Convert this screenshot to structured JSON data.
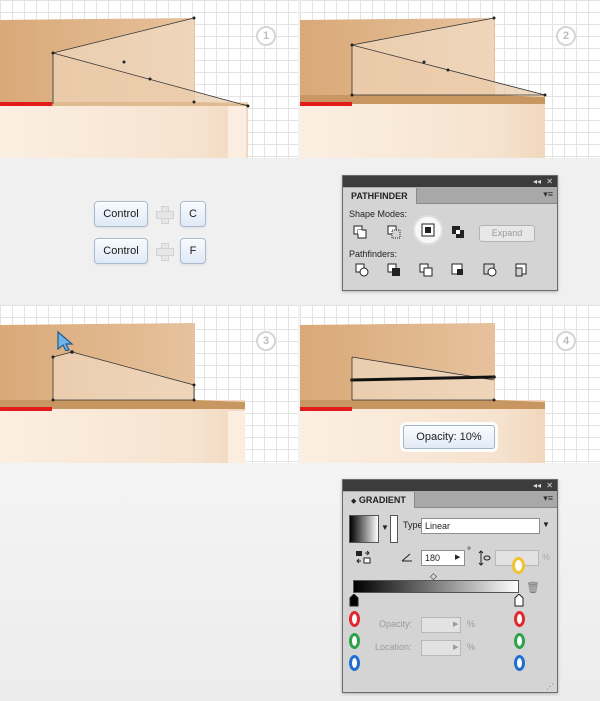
{
  "steps": [
    "1",
    "2",
    "3",
    "4"
  ],
  "shortcuts": {
    "row1": {
      "modifier": "Control",
      "key": "C"
    },
    "row2": {
      "modifier": "Control",
      "key": "F"
    }
  },
  "pathfinder": {
    "title": "PATHFINDER",
    "shape_modes_label": "Shape Modes:",
    "pathfinders_label": "Pathfinders:",
    "expand_label": "Expand",
    "shape_mode_icons": [
      "unite-icon",
      "minus-front-icon",
      "intersect-icon",
      "exclude-icon"
    ],
    "pathfinder_icons": [
      "divide-icon",
      "trim-icon",
      "merge-icon",
      "crop-icon",
      "outline-icon",
      "minus-back-icon"
    ]
  },
  "opacity_badge": "Opacity: 10%",
  "gradient": {
    "title": "GRADIENT",
    "type_label": "Type:",
    "type_value": "Linear",
    "angle_value": "180",
    "degree_symbol": "°",
    "percent_symbol": "%",
    "opacity_label": "Opacity:",
    "location_label": "Location:",
    "highlight_color": "#f2c230"
  },
  "colors": {
    "accent_red": "#e41b1b",
    "shape_tan": "#d4a373",
    "key_border": "#aabbd0"
  }
}
